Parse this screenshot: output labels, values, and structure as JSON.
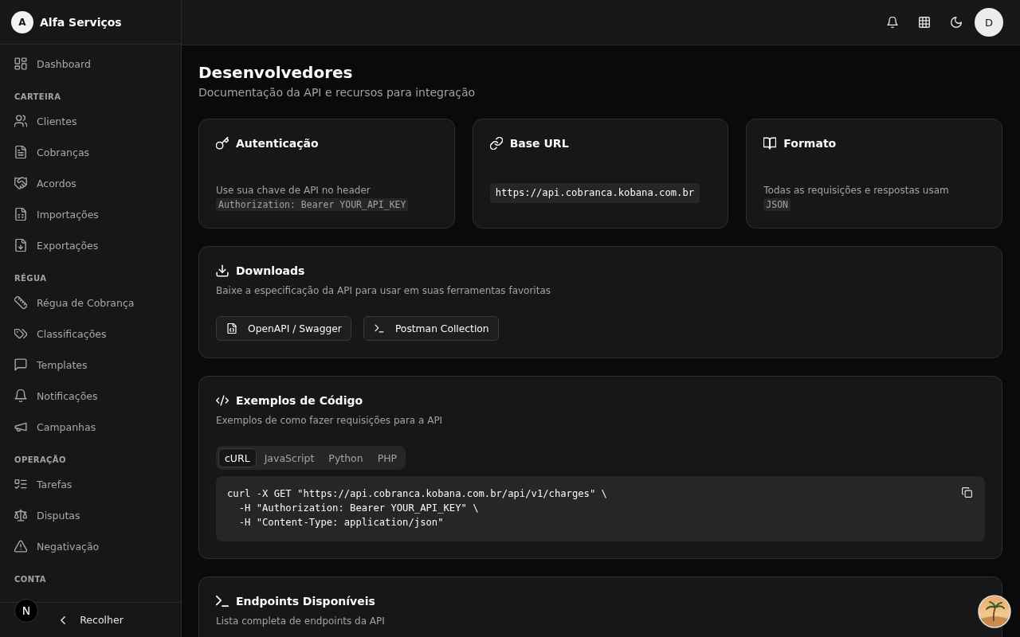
{
  "sidebar": {
    "brand": {
      "initial": "A",
      "name": "Alfa Serviços"
    },
    "sections": [
      {
        "items": [
          {
            "label": "Dashboard",
            "selected": false
          }
        ]
      },
      {
        "label": "CARTEIRA",
        "items": [
          {
            "label": "Clientes",
            "selected": false
          },
          {
            "label": "Cobranças",
            "selected": false
          },
          {
            "label": "Acordos",
            "selected": false
          },
          {
            "label": "Importações",
            "selected": false
          },
          {
            "label": "Exportações",
            "selected": false
          }
        ]
      },
      {
        "label": "RÉGUA",
        "items": [
          {
            "label": "Régua de Cobrança",
            "selected": false
          },
          {
            "label": "Classificações",
            "selected": false
          },
          {
            "label": "Templates",
            "selected": false
          },
          {
            "label": "Notificações",
            "selected": false
          },
          {
            "label": "Campanhas",
            "selected": false
          }
        ]
      },
      {
        "label": "OPERAÇÃO",
        "items": [
          {
            "label": "Tarefas",
            "selected": false
          },
          {
            "label": "Disputas",
            "selected": false
          },
          {
            "label": "Negativação",
            "selected": false
          }
        ]
      },
      {
        "label": "CONTA"
      }
    ],
    "collapse": {
      "label": "Recolher"
    }
  },
  "dev_badge": "N",
  "header": {
    "avatar_initial": "D"
  },
  "page": {
    "title": "Desenvolvedores",
    "subtitle": "Documentação da API e recursos para integração"
  },
  "info_cards": [
    {
      "kind": "note",
      "title": "Autenticação",
      "text": "Use sua chave de API no header",
      "code": "Authorization: Bearer YOUR_API_KEY"
    },
    {
      "kind": "url",
      "title": "Base URL",
      "code": "https://api.cobranca.kobana.com.br"
    },
    {
      "kind": "note",
      "title": "Formato",
      "text": "Todas as requisições e respostas usam",
      "code": "JSON"
    }
  ],
  "downloads": {
    "title": "Downloads",
    "description": "Baixe a especificação da API para usar em suas ferramentas favoritas",
    "buttons": [
      "OpenAPI / Swagger",
      "Postman Collection"
    ]
  },
  "code_examples": {
    "title": "Exemplos de Código",
    "description": "Exemplos de como fazer requisições para a API",
    "tabs": [
      {
        "label": "cURL",
        "selected": true
      },
      {
        "label": "JavaScript",
        "selected": false
      },
      {
        "label": "Python",
        "selected": false
      },
      {
        "label": "PHP",
        "selected": false
      }
    ],
    "code_lines": [
      "curl -X GET \"https://api.cobranca.kobana.com.br/api/v1/charges\" \\",
      "  -H \"Authorization: Bearer YOUR_API_KEY\" \\",
      "  -H \"Content-Type: application/json\""
    ]
  },
  "endpoints": {
    "title": "Endpoints Disponíveis",
    "description": "Lista completa de endpoints da API"
  }
}
